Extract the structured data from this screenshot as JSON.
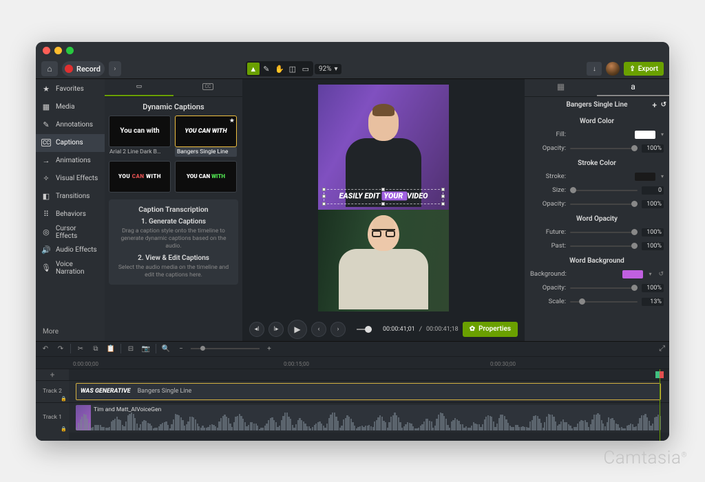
{
  "window": {
    "record_label": "Record",
    "export_label": "Export",
    "zoom": "92%"
  },
  "sidebar": {
    "items": [
      {
        "icon": "★",
        "label": "Favorites"
      },
      {
        "icon": "▦",
        "label": "Media"
      },
      {
        "icon": "✎",
        "label": "Annotations"
      },
      {
        "icon": "CC",
        "label": "Captions"
      },
      {
        "icon": "→",
        "label": "Animations"
      },
      {
        "icon": "✧",
        "label": "Visual Effects"
      },
      {
        "icon": "◧",
        "label": "Transitions"
      },
      {
        "icon": "⠿",
        "label": "Behaviors"
      },
      {
        "icon": "◎",
        "label": "Cursor Effects"
      },
      {
        "icon": "🔊",
        "label": "Audio Effects"
      },
      {
        "icon": "🎙",
        "label": "Voice Narration"
      }
    ],
    "more": "More"
  },
  "library": {
    "section_title": "Dynamic Captions",
    "transcription_title": "Caption Transcription",
    "steps": [
      {
        "title": "1. Generate Captions",
        "desc": "Drag a caption style onto the timeline to generate dynamic captions based on the audio."
      },
      {
        "title": "2. View & Edit Captions",
        "desc": "Select the audio media on the timeline and edit the captions here."
      }
    ],
    "thumbs": [
      {
        "preview": "You can with",
        "label": "Arial 2 Line Dark B…",
        "selected": false
      },
      {
        "preview": "YOU CAN WITH",
        "label": "Bangers Single Line",
        "selected": true
      },
      {
        "preview_html": "YOU CAN WITH",
        "label": "",
        "selected": false
      },
      {
        "preview_html": "YOU CAN WITH",
        "label": "",
        "selected": false
      }
    ]
  },
  "canvas": {
    "caption_pre": "EASILY EDIT ",
    "caption_box": "YOUR ",
    "caption_post": "VIDEO"
  },
  "playback": {
    "timecode_current": "00:00:41;01",
    "timecode_total": "00:00:41;18",
    "properties_btn": "Properties"
  },
  "properties": {
    "title": "Bangers Single Line",
    "sections": {
      "word_color": {
        "heading": "Word Color",
        "fill_label": "Fill:",
        "fill_color": "#ffffff",
        "opacity_label": "Opacity:",
        "opacity": "100%"
      },
      "stroke_color": {
        "heading": "Stroke Color",
        "stroke_label": "Stroke:",
        "stroke_color": "#1a1a1a",
        "size_label": "Size:",
        "size": "0",
        "opacity_label": "Opacity:",
        "opacity": "100%"
      },
      "word_opacity": {
        "heading": "Word Opacity",
        "future_label": "Future:",
        "future": "100%",
        "past_label": "Past:",
        "past": "100%"
      },
      "word_background": {
        "heading": "Word Background",
        "bg_label": "Background:",
        "bg_color": "#c060e0",
        "opacity_label": "Opacity:",
        "opacity": "100%",
        "scale_label": "Scale:",
        "scale": "13%"
      }
    }
  },
  "timeline": {
    "ruler": [
      "0:00:00;00",
      "0:00:15;00",
      "0:00:30;00"
    ],
    "tracks": [
      {
        "name": "Track 2",
        "clip_text": "WAS GENERATIVE",
        "clip_label": "Bangers Single Line"
      },
      {
        "name": "Track 1",
        "clip_label": "Tim and Matt_AIVoiceGen"
      }
    ]
  },
  "watermark": "Camtasia"
}
